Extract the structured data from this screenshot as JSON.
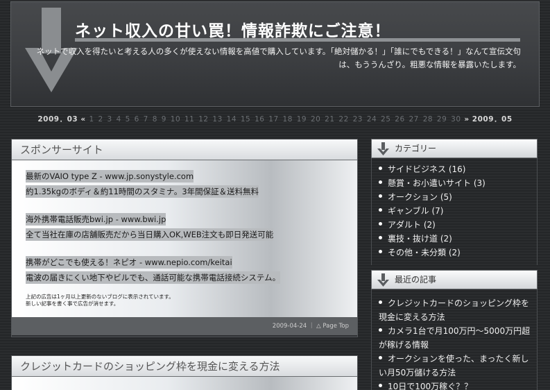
{
  "header": {
    "title": "ネット収入の甘い罠！情報詐欺にご注意！",
    "description_line1": "ネットで収入を得たいと考える人の多くが使えない情報を高値で購入しています。「絶対儲かる！」「誰にでもできる！」なんて宣伝文句",
    "description_line2": "は、もううんざり。粗悪な情報を暴露いたします。"
  },
  "pager": {
    "prev": "2009．03 «",
    "days": [
      "1",
      "2",
      "3",
      "4",
      "5",
      "6",
      "7",
      "8",
      "9",
      "10",
      "11",
      "12",
      "13",
      "14",
      "15",
      "16",
      "17",
      "18",
      "19",
      "20",
      "21",
      "22",
      "23",
      "24",
      "25",
      "26",
      "27",
      "28",
      "29",
      "30"
    ],
    "next": "» 2009．05"
  },
  "post1": {
    "title": "スポンサーサイト",
    "ads": [
      "最新のVAIO type Z - www.jp.sonystyle.com",
      "約1.35kgのボディ＆約11時間のスタミナ。3年間保証＆送料無料",
      "",
      "海外携帯電話販売bwi.jp - www.bwi.jp",
      "全て当社在庫の店舗販売だから当日購入OK,WEB注文も即日発送可能",
      "",
      "携帯がどこでも使える！ネピオ - www.nepio.com/keitai",
      "電波の届きにくい地下やビルでも、通話可能な携帯電話接続システム。"
    ],
    "note_line1": "上記の広告は1ヶ月以上更新のないブログに表示されています。",
    "note_line2": "新しい記事を書く事で広告が消せます。",
    "date": "2009-04-24",
    "separator": "｜",
    "page_top": "△ Page Top"
  },
  "post2": {
    "title": "クレジットカードのショッピング枠を現金に変える方法"
  },
  "sidebar": {
    "categories_title": "カテゴリー",
    "categories": [
      "サイドビジネス (16)",
      "懸賞・お小遣いサイト (3)",
      "オークション (5)",
      "ギャンブル (7)",
      "アダルト (2)",
      "裏技・抜け道 (2)",
      "その他・未分類 (2)"
    ],
    "recent_title": "最近の記事",
    "recent": [
      "クレジットカードのショッピング枠を現金に変える方法",
      "カメラ1台で月100万円～5000万円超が稼げる情報",
      "オークションを使った、まったく新しい月50万儲ける方法",
      "10日で100万稼ぐ？？"
    ]
  }
}
